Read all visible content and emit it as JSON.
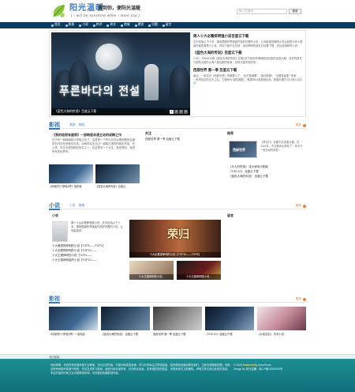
{
  "site": {
    "brand": "阳光温暖",
    "slogan": "遇到你，便阳光温暖",
    "sub": "( i will be sunshine when i meet you )",
    "search_placeholder": "输入关键词...",
    "search_button": "搜索"
  },
  "nav": [
    "首页",
    "影视",
    "小说",
    "转评",
    "原文",
    "商城",
    "猜答",
    "问题",
    "留言"
  ],
  "hero": {
    "title_art": "푸른바다의 전설",
    "caption": "《蓝色大海的传说》百度云下载",
    "dots": [
      "1",
      "2",
      "3",
      "4"
    ],
    "news": [
      {
        "title": "周人十大必看郎明强小说百度云下载",
        "text": "文中包括以下十本：湖间里翻车预谋者作品好好看的小说，让你能量到晚明小说从起提卡的十部最好最的周男人小说，林实力都不住在就，喜欢郎明的朋友们请看下载，还包含周郎的小说..."
      },
      {
        "title": "《蓝色大海的传说》百度云下载",
        "text": "1415，SBS水木剧《蓝色大海的传说》并第1次于宣布获得韩国自化剧的全部大题，讲述的是先行新的大胆的大海人鱼姑娘的故事，在现代宝贵相关的..."
      },
      {
        "title": "西部世界 第一季 百度云下载",
        "text": "最近，一部名为《西部世界》的美剧火了，\"全天堂摘要\"、\"最佳新剧\"、\"全国真最爱\"\"来宝\" ……一系列炫目的名头之后，它被称为\"超真美剧\"。美国HBO电视网出品，首播日期于2016年10月2日..."
      }
    ]
  },
  "film": {
    "name": "影视",
    "tabs": [
      "美剧",
      "韩剧"
    ],
    "more": "更多",
    "feature_title": "《我的极限有度限》一部韩版非漫主动的成精之作",
    "feature_text": "在于有一部韩版新片即版正在了。这是是一个所以存在近期他看其后度的在内存在就像也可成，对两他将无法过一部韩打造的的精彩作品，在以来，所生世里的精彩的本之一，在这里向一个大生，就世界的，就到所有的世界有...",
    "thumbs": [
      "《伴我同行 哆啦A梦》电影版",
      "《蓝色大海的传说》百度云..."
    ],
    "focus_label": "关注",
    "focus_list": [
      "西部世界 第一季 百度云下载"
    ],
    "rec_label": "推荐",
    "rec_img_title": "西部世界",
    "rec_text": "《摩点行》定期不定或更点播，在2016年，不日期内出现在了，你卡不一是自动的精彩...",
    "rec_list": [
      "《为人的终极》 本大家到小剧影",
      "《THE K2》 百度云下载",
      "《蓝色大海的传说》 百度云下载"
    ]
  },
  "novel": {
    "name": "小说",
    "tabs": [
      "小说",
      "随笔"
    ],
    "more": "更多",
    "col1_label": "小说",
    "item_text": "周人十大必看郎明强小说，文中包括以下十本，湖间里翻车预谋者作品好好看的小说，让你能量到...",
    "list": [
      "十大最想提郎明的小说【TOP5——TOP1】",
      "十大必看提郎明的小说【TOP10——",
      "十大王建郎明的小说【TOP4——",
      "十大王建郎明强的小说【TOP10——"
    ],
    "poster_title": "荣归",
    "poster_caption": "十大必看提郎明的小说【TOP10——TOP6】",
    "small_posters": [
      "十大王建郎明强小说...",
      "十大王建郎明强小说..."
    ],
    "col3_label": "留言"
  },
  "video": {
    "name": "影视",
    "more": "更多",
    "items": [
      "《伴我同行 哆啦A梦》一部电影",
      "《蓝色大海的传说》 百度云下载",
      "西部世界 第一季 百度云下载",
      "《THE K2》百度云下载",
      "《大地生机》 鲁本小说..."
    ]
  },
  "bottombar": "友情链接：",
  "footer": {
    "text": "特别申明：本站所有资源来源于互联网，仅为交流所用，不提示转发或资源，学习分享标注文章信息者，如有侵权资源请联系我们，立即为您删除处理。本网站所有资源均来源于网络，仅供交流学习使用，版权归原作者所有，请勿商业用途，如有侵犯您的权益，请联系我们立即删除。声明文章引用出处相关信息，本站开始的时间之后可能受到影响，请勿擅自传播原创作品。",
    "copyright": "© 2016",
    "powered_label": "Powered By",
    "powered": "WordPress",
    "design": "Design By 阳光温暖 · 粤ICP备15000000号"
  },
  "colors": {
    "brand": "#3e7ab8",
    "nav_bg": "#0e3b5d",
    "section": "#3d7ab3",
    "more": "#d0782a",
    "footer": "#1e8f94"
  }
}
